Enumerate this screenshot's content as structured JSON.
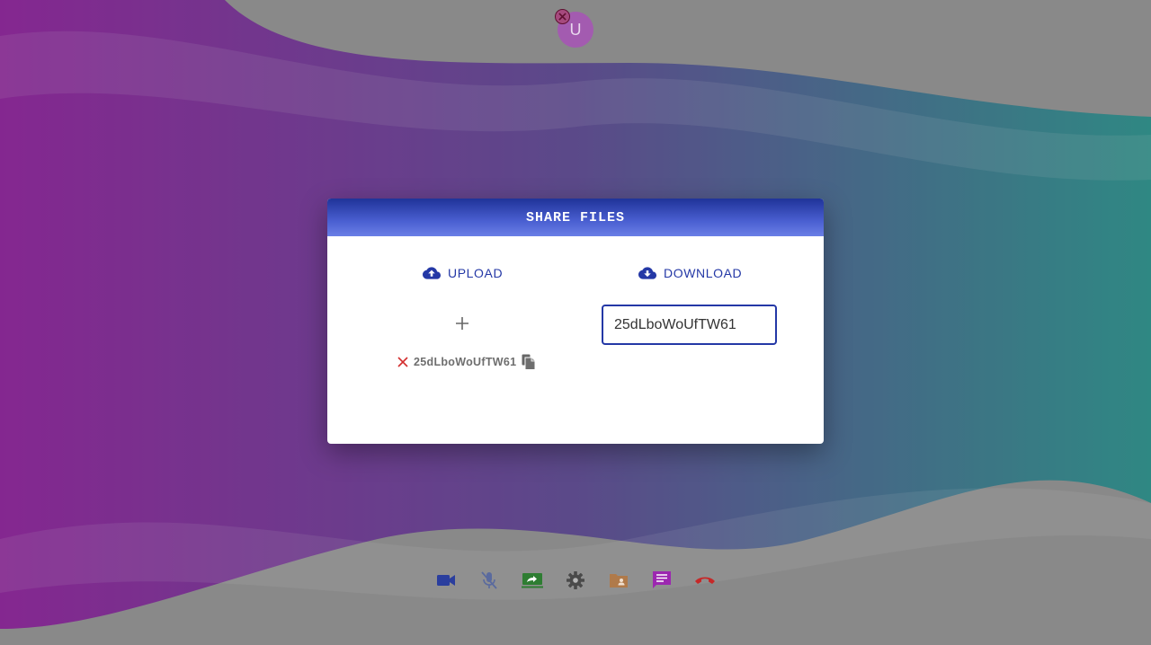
{
  "avatar": {
    "initial": "U"
  },
  "dialog": {
    "title": "SHARE FILES",
    "upload_label": "UPLOAD",
    "download_label": "DOWNLOAD",
    "shared_file_code": "25dLboWoUfTW61",
    "download_code_value": "25dLboWoUfTW61"
  },
  "toolbar": {
    "icons": [
      "video-camera-icon",
      "microphone-off-icon",
      "screen-share-icon",
      "settings-gear-icon",
      "shared-folder-icon",
      "chat-icon",
      "hang-up-icon"
    ]
  },
  "colors": {
    "accent": "#2438a6",
    "header_gradient_start": "#1f3399",
    "header_gradient_end": "#6a7fe6",
    "remove_red": "#d32f2f",
    "hangup_red": "#c62828"
  }
}
